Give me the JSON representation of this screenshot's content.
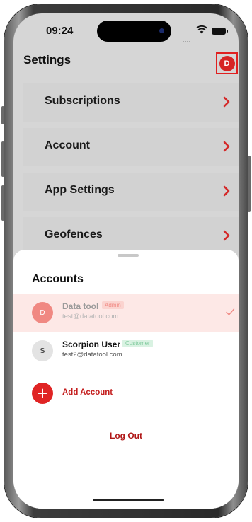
{
  "status_bar": {
    "time": "09:24"
  },
  "header": {
    "title": "Settings",
    "avatar_initial": "D"
  },
  "menu": {
    "items": [
      {
        "label": "Subscriptions"
      },
      {
        "label": "Account"
      },
      {
        "label": "App Settings"
      },
      {
        "label": "Geofences"
      }
    ]
  },
  "accounts_sheet": {
    "title": "Accounts",
    "accounts": [
      {
        "initial": "D",
        "name": "Data tool",
        "role": "Admin",
        "email": "test@datatool.com",
        "selected": true
      },
      {
        "initial": "S",
        "name": "Scorpion User",
        "role": "Customer",
        "email": "test2@datatool.com",
        "selected": false
      }
    ],
    "add_account_label": "Add Account",
    "logout_label": "Log Out"
  },
  "colors": {
    "accent_red": "#e02424",
    "selected_row_bg": "#fde8e6",
    "admin_badge_text": "#f08a84",
    "customer_badge_text": "#7cc89a"
  },
  "icons": [
    "chevron-right-icon",
    "checkmark-icon",
    "plus-icon",
    "wifi-icon",
    "battery-icon"
  ]
}
